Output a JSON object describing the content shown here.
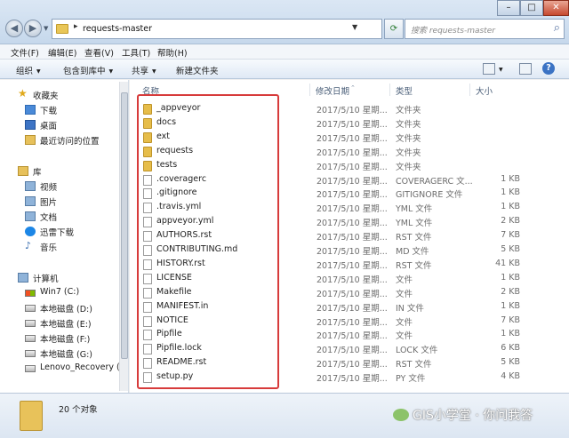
{
  "window": {
    "address_path": "requests-master",
    "search_placeholder": "搜索 requests-master"
  },
  "menu": [
    "文件(F)",
    "编辑(E)",
    "查看(V)",
    "工具(T)",
    "帮助(H)"
  ],
  "toolbar": {
    "organize": "组织",
    "include_in_library": "包含到库中",
    "share": "共享",
    "new_folder": "新建文件夹"
  },
  "columns": {
    "name": "名称",
    "date": "修改日期",
    "type": "类型",
    "size": "大小"
  },
  "nav": {
    "favorites": "收藏夹",
    "downloads": "下载",
    "desktop": "桌面",
    "recent": "最近访问的位置",
    "libraries": "库",
    "videos": "视频",
    "pictures": "图片",
    "documents": "文档",
    "xunlei": "迅雷下载",
    "music": "音乐",
    "computer": "计算机",
    "drive_c": "Win7 (C:)",
    "drive_d": "本地磁盘 (D:)",
    "drive_e": "本地磁盘 (E:)",
    "drive_f": "本地磁盘 (F:)",
    "drive_g": "本地磁盘 (G:)",
    "drive_h": "Lenovo_Recovery (H"
  },
  "files": [
    {
      "name": "_appveyor",
      "date": "2017/5/10 星期...",
      "type": "文件夹",
      "size": "",
      "folder": true
    },
    {
      "name": "docs",
      "date": "2017/5/10 星期...",
      "type": "文件夹",
      "size": "",
      "folder": true
    },
    {
      "name": "ext",
      "date": "2017/5/10 星期...",
      "type": "文件夹",
      "size": "",
      "folder": true
    },
    {
      "name": "requests",
      "date": "2017/5/10 星期...",
      "type": "文件夹",
      "size": "",
      "folder": true
    },
    {
      "name": "tests",
      "date": "2017/5/10 星期...",
      "type": "文件夹",
      "size": "",
      "folder": true
    },
    {
      "name": ".coveragerc",
      "date": "2017/5/10 星期...",
      "type": "COVERAGERC 文...",
      "size": "1 KB",
      "folder": false
    },
    {
      "name": ".gitignore",
      "date": "2017/5/10 星期...",
      "type": "GITIGNORE 文件",
      "size": "1 KB",
      "folder": false
    },
    {
      "name": ".travis.yml",
      "date": "2017/5/10 星期...",
      "type": "YML 文件",
      "size": "1 KB",
      "folder": false
    },
    {
      "name": "appveyor.yml",
      "date": "2017/5/10 星期...",
      "type": "YML 文件",
      "size": "2 KB",
      "folder": false
    },
    {
      "name": "AUTHORS.rst",
      "date": "2017/5/10 星期...",
      "type": "RST 文件",
      "size": "7 KB",
      "folder": false
    },
    {
      "name": "CONTRIBUTING.md",
      "date": "2017/5/10 星期...",
      "type": "MD 文件",
      "size": "5 KB",
      "folder": false
    },
    {
      "name": "HISTORY.rst",
      "date": "2017/5/10 星期...",
      "type": "RST 文件",
      "size": "41 KB",
      "folder": false
    },
    {
      "name": "LICENSE",
      "date": "2017/5/10 星期...",
      "type": "文件",
      "size": "1 KB",
      "folder": false
    },
    {
      "name": "Makefile",
      "date": "2017/5/10 星期...",
      "type": "文件",
      "size": "2 KB",
      "folder": false
    },
    {
      "name": "MANIFEST.in",
      "date": "2017/5/10 星期...",
      "type": "IN 文件",
      "size": "1 KB",
      "folder": false
    },
    {
      "name": "NOTICE",
      "date": "2017/5/10 星期...",
      "type": "文件",
      "size": "7 KB",
      "folder": false
    },
    {
      "name": "Pipfile",
      "date": "2017/5/10 星期...",
      "type": "文件",
      "size": "1 KB",
      "folder": false
    },
    {
      "name": "Pipfile.lock",
      "date": "2017/5/10 星期...",
      "type": "LOCK 文件",
      "size": "6 KB",
      "folder": false
    },
    {
      "name": "README.rst",
      "date": "2017/5/10 星期...",
      "type": "RST 文件",
      "size": "5 KB",
      "folder": false
    },
    {
      "name": "setup.py",
      "date": "2017/5/10 星期...",
      "type": "PY 文件",
      "size": "4 KB",
      "folder": false
    }
  ],
  "status": {
    "count": "20 个对象"
  },
  "watermark": "GIS小学堂 · 你问我答",
  "colors": {
    "highlight": "#d73b3b",
    "folder": "#e6bd4a"
  }
}
